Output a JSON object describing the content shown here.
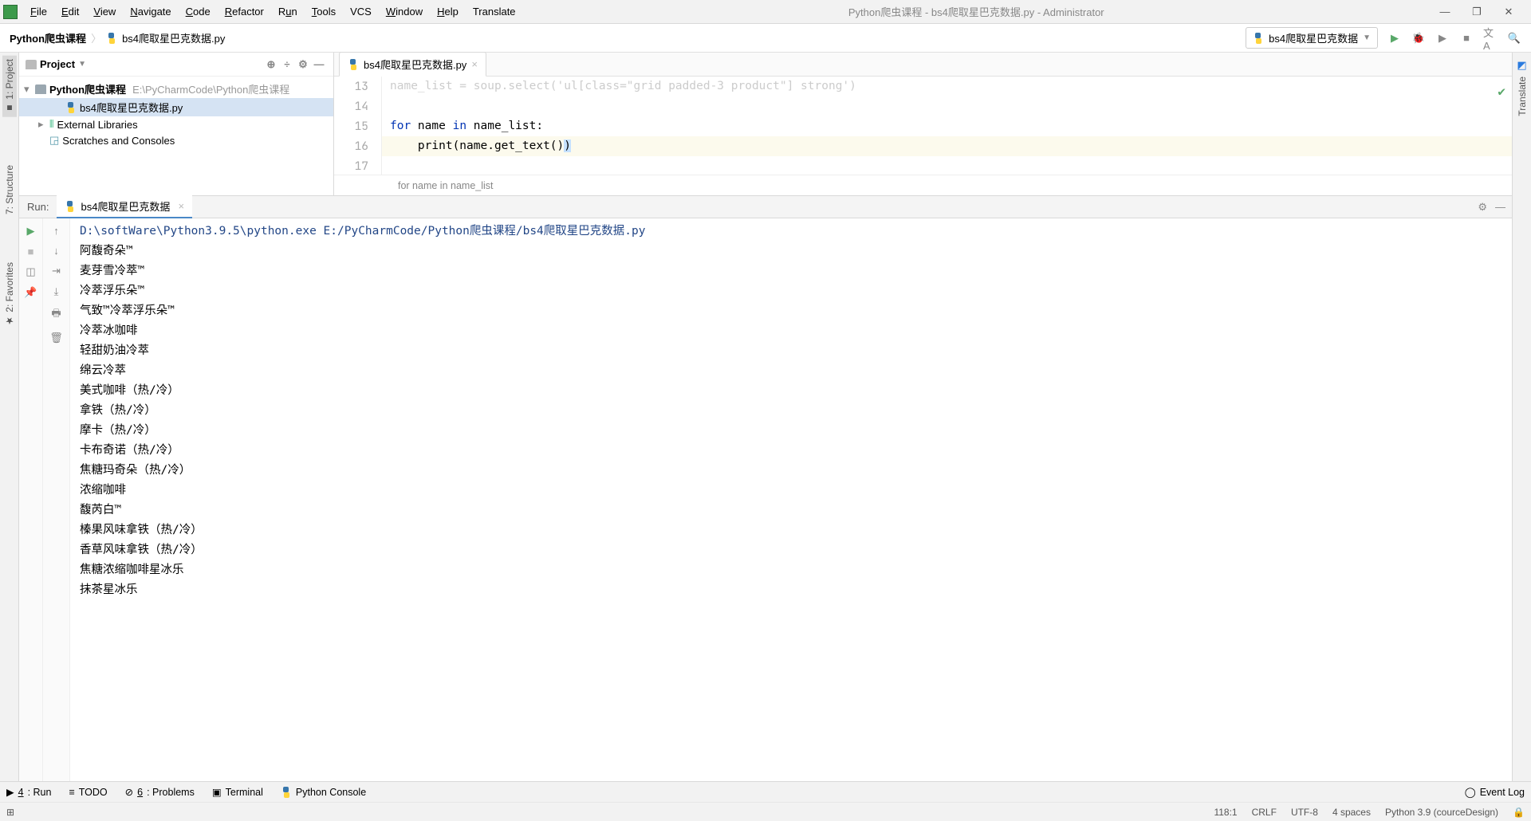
{
  "window": {
    "title": "Python爬虫课程 - bs4爬取星巴克数据.py - Administrator"
  },
  "menu": {
    "file": "File",
    "edit": "Edit",
    "view": "View",
    "navigate": "Navigate",
    "code": "Code",
    "refactor": "Refactor",
    "run": "Run",
    "tools": "Tools",
    "vcs": "VCS",
    "window": "Window",
    "help": "Help",
    "translate": "Translate"
  },
  "breadcrumb": {
    "project": "Python爬虫课程",
    "file": "bs4爬取星巴克数据.py"
  },
  "runconfig": {
    "name": "bs4爬取星巴克数据"
  },
  "leftRail": {
    "project": "1: Project",
    "structure": "7: Structure",
    "favorites": "2: Favorites"
  },
  "rightRail": {
    "translate": "Translate"
  },
  "projectPanel": {
    "title": "Project",
    "root": "Python爬虫课程",
    "rootPath": "E:\\PyCharmCode\\Python爬虫课程",
    "file": "bs4爬取星巴克数据.py",
    "extLib": "External Libraries",
    "scratch": "Scratches and Consoles"
  },
  "editor": {
    "tab": "bs4爬取星巴克数据.py",
    "gutter": [
      "13",
      "14",
      "15",
      "16",
      "17"
    ],
    "partial": "name_list = soup.select('ul[class=\"grid padded-3 product\"] strong')",
    "line15a": "for",
    "line15b": " name ",
    "line15c": "in",
    "line15d": " name_list:",
    "line16a": "print",
    "line16b": "(name.get_text()",
    "line16c": ")",
    "crumb": "for name in name_list"
  },
  "run": {
    "label": "Run:",
    "tab": "bs4爬取星巴克数据",
    "cmd": "D:\\softWare\\Python3.9.5\\python.exe E:/PyCharmCode/Python爬虫课程/bs4爬取星巴克数据.py",
    "lines": [
      "阿馥奇朵™",
      "麦芽雪冷萃™",
      "冷萃浮乐朵™",
      "气致™冷萃浮乐朵™",
      "冷萃冰咖啡",
      "轻甜奶油冷萃",
      "绵云冷萃",
      "美式咖啡（热/冷）",
      "拿铁（热/冷）",
      "摩卡（热/冷）",
      "卡布奇诺（热/冷）",
      "焦糖玛奇朵（热/冷）",
      "浓缩咖啡",
      "馥芮白™",
      "榛果风味拿铁（热/冷）",
      "香草风味拿铁（热/冷）",
      "焦糖浓缩咖啡星冰乐",
      "抹茶星冰乐"
    ]
  },
  "bottom": {
    "run": "4: Run",
    "todo": "TODO",
    "problems": "6: Problems",
    "terminal": "Terminal",
    "pyconsole": "Python Console",
    "eventlog": "Event Log"
  },
  "status": {
    "pos": "118:1",
    "eol": "CRLF",
    "enc": "UTF-8",
    "indent": "4 spaces",
    "interp": "Python 3.9 (courceDesign)"
  }
}
